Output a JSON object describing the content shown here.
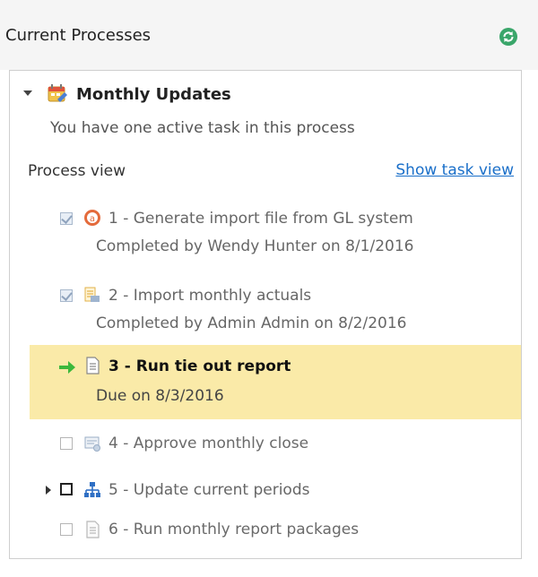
{
  "header": {
    "title": "Current Processes",
    "refresh_icon": "refresh-icon"
  },
  "process": {
    "title": "Monthly Updates",
    "subtitle": "You have one active task in this process",
    "icon": "process-calendar-icon",
    "view_label": "Process view",
    "show_task_link": "Show task view"
  },
  "tasks": [
    {
      "name": "1 - Generate import file from GL system",
      "detail": "Completed by Wendy Hunter on 8/1/2016",
      "status": "completed",
      "icon": "gl-system-icon"
    },
    {
      "name": "2 - Import monthly actuals",
      "detail": "Completed by Admin Admin on 8/2/2016",
      "status": "completed",
      "icon": "import-icon"
    },
    {
      "name": "3 - Run tie out report",
      "detail": "Due on 8/3/2016",
      "status": "active",
      "icon": "report-icon"
    },
    {
      "name": "4 - Approve monthly close",
      "detail": "",
      "status": "pending",
      "icon": "approve-icon"
    },
    {
      "name": "5 - Update current periods",
      "detail": "",
      "status": "pending-expandable",
      "icon": "hierarchy-icon"
    },
    {
      "name": "6 - Run monthly report packages",
      "detail": "",
      "status": "pending",
      "icon": "report-package-icon"
    }
  ],
  "colors": {
    "active_row": "#faeaa8",
    "link": "#1a6fc9",
    "refresh": "#3aa66a",
    "arrow": "#3cb83c"
  }
}
